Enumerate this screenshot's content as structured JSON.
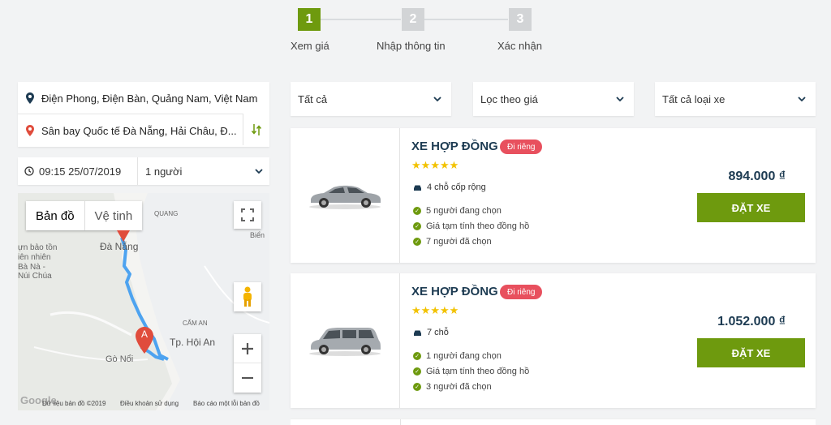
{
  "stepper": {
    "steps": [
      {
        "number": "1",
        "label": "Xem giá",
        "state": "active"
      },
      {
        "number": "2",
        "label": "Nhập thông tin",
        "state": "inactive"
      },
      {
        "number": "3",
        "label": "Xác nhận",
        "state": "inactive"
      }
    ]
  },
  "search": {
    "origin": "Điện Phong, Điện Bàn, Quảng Nam, Việt Nam",
    "destination": "Sân bay Quốc tế Đà Nẵng, Hải Châu, Đ...",
    "datetime": "09:15 25/07/2019",
    "passengers": "1 người"
  },
  "map": {
    "tabs": [
      "Bản đồ",
      "Vệ tinh"
    ],
    "labels": {
      "quang": "QUANG",
      "da_nang": "Đà Nẵng",
      "bien": "Biển",
      "bao_ton1": "ựn bảo tồn",
      "bao_ton2": "iên nhiên",
      "ba_na": "Bà Nà -",
      "nui_chua": "Núi Chúa",
      "cam_an": "CẨM AN",
      "hoi_an": "Tp. Hội An",
      "go_noi": "Gò Nổi",
      "marker_a": "A"
    },
    "footer": {
      "copyright": "Dữ liệu bản đồ ©2019",
      "terms": "Điều khoản sử dụng",
      "report": "Báo cáo một lỗi bản đồ",
      "logo": "Google"
    }
  },
  "filters": {
    "all": "Tất cả",
    "price": "Lọc theo giá",
    "vehicle_type": "Tất cả loại xe"
  },
  "vehicles": [
    {
      "title": "XE HỢP ĐỒNG",
      "badge": "Đi riêng",
      "rating": 5,
      "seats": "4 chỗ cốp rộng",
      "features": [
        "5 người đang chọn",
        "Giá tạm tính theo đồng hồ",
        "7 người đã chọn"
      ],
      "price": "894.000 ₫",
      "button": "ĐẶT XE"
    },
    {
      "title": "XE HỢP ĐỒNG",
      "badge": "Đi riêng",
      "rating": 5,
      "seats": "7 chỗ",
      "features": [
        "1 người đang chọn",
        "Giá tạm tính theo đồng hồ",
        "3 người đã chọn"
      ],
      "price": "1.052.000 ₫",
      "button": "ĐẶT XE"
    }
  ],
  "colors": {
    "accent": "#6e9a0e",
    "badge": "#e8505e",
    "title": "#1d3b52",
    "route": "#4da3f0",
    "marker": "#e04c3c"
  }
}
